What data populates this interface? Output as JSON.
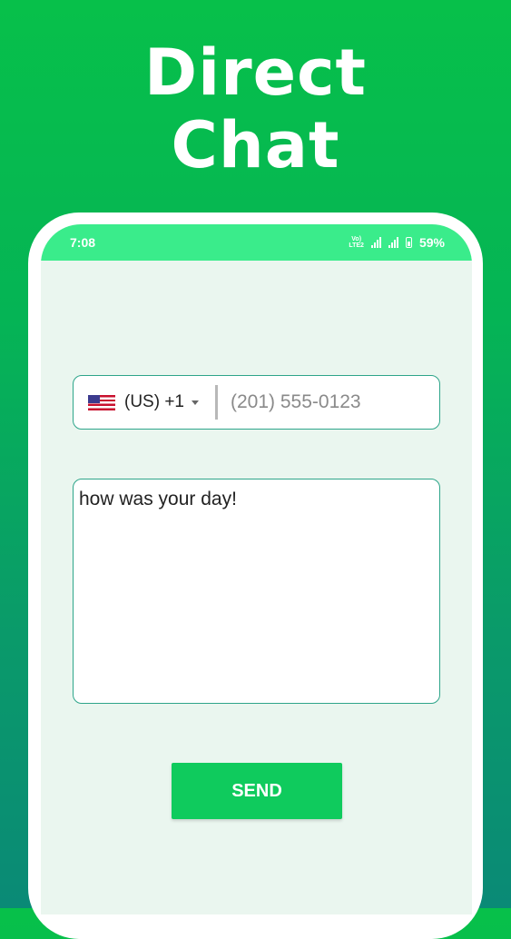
{
  "promo": {
    "headline": "Direct\nChat"
  },
  "status_bar": {
    "time": "7:08",
    "network": "Vo)\nLTE2",
    "battery": "59%"
  },
  "form": {
    "country_code": "(US) +1",
    "phone_placeholder": "(201) 555-0123",
    "message": "how was your day!",
    "send_label": "SEND"
  },
  "colors": {
    "brand_green": "#0fcb5d",
    "status_bar": "#3aec8b",
    "field_border": "#2ea58a"
  },
  "icons": [
    "us-flag-icon",
    "dropdown-caret-icon",
    "signal-icon",
    "battery-icon"
  ]
}
